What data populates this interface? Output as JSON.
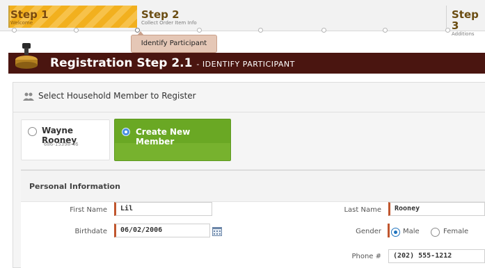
{
  "steps": [
    {
      "title": "Step 1",
      "subtitle": "Welcome"
    },
    {
      "title": "Step 2",
      "subtitle": "Collect Order Item Info"
    },
    {
      "title": "Step 3",
      "subtitle": "Additions"
    }
  ],
  "tooltip": "Identify Participant",
  "banner": {
    "title": "Registration Step 2.1",
    "subtitle": "- IDENTIFY PARTICIPANT"
  },
  "household": {
    "title": "Select Household Member to Register",
    "members": [
      {
        "name": "Wayne Rooney",
        "id": "686-15398-46"
      }
    ],
    "create_label": "Create New Member"
  },
  "personal": {
    "title": "Personal Information",
    "first_name_label": "First Name",
    "first_name": "Lil",
    "last_name_label": "Last Name",
    "last_name": "Rooney",
    "birthdate_label": "Birthdate",
    "birthdate": "06/02/2006",
    "gender_label": "Gender",
    "gender_options": [
      "Male",
      "Female"
    ],
    "phone_label": "Phone #",
    "phone": "(202) 555-1212"
  },
  "colors": {
    "banner": "#4a1510",
    "accent_green": "#77b22e",
    "step_active": "#f2b01e",
    "field_marker": "#c0562e"
  }
}
